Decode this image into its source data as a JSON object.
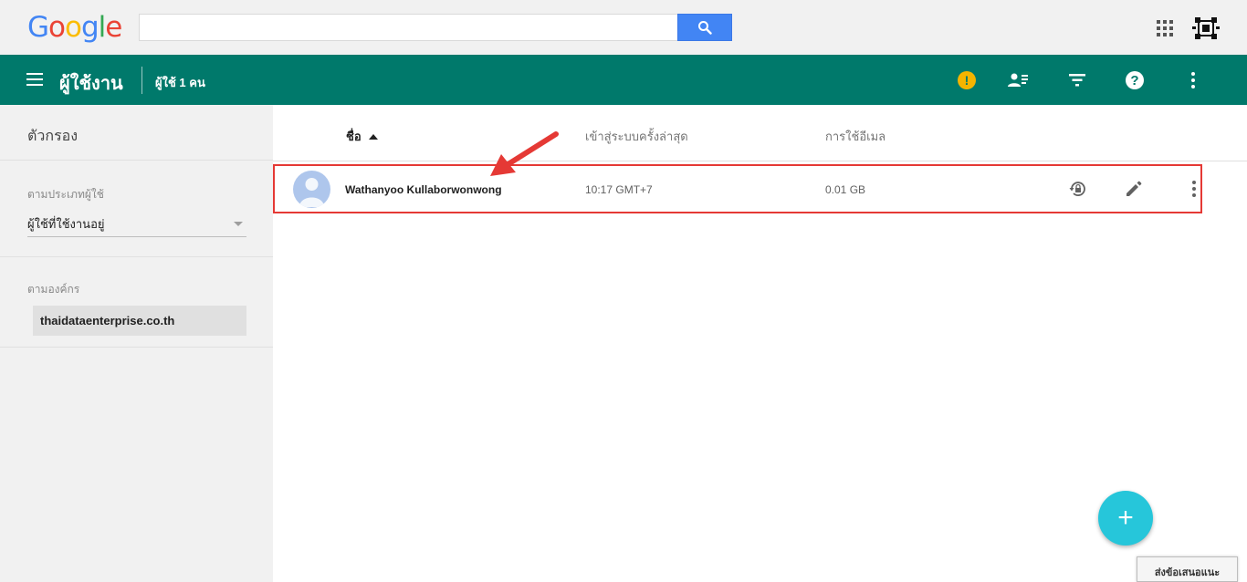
{
  "google_bar": {
    "logo_letters": [
      "G",
      "o",
      "o",
      "g",
      "l",
      "e"
    ],
    "logo_colors": [
      "#4285f4",
      "#ea4335",
      "#fbbc05",
      "#4285f4",
      "#34a853",
      "#ea4335"
    ],
    "search": {
      "value": "",
      "placeholder": ""
    },
    "icons": [
      "search-icon",
      "apps-grid-icon",
      "organization-logo"
    ]
  },
  "app_header": {
    "title": "ผู้ใช้งาน",
    "user_count": "ผู้ใช้ 1 คน",
    "accent_color": "#00796b",
    "icons": [
      "warning-icon",
      "add-user-icon",
      "filter-icon",
      "help-icon",
      "more-vert-icon"
    ]
  },
  "sidebar": {
    "title": "ตัวกรอง",
    "user_type": {
      "label": "ตามประเภทผู้ใช้",
      "selected": "ผู้ใช้ที่ใช้งานอยู่"
    },
    "org": {
      "label": "ตามองค์กร",
      "value": "thaidataenterprise.co.th"
    }
  },
  "table": {
    "columns": [
      "ชื่อ",
      "เข้าสู่ระบบครั้งล่าสุด",
      "การใช้อีเมล"
    ],
    "sort": "ascending",
    "rows": [
      {
        "name": "Wathanyoo Kullaborwonwong",
        "last_login": "10:17 GMT+7",
        "email_usage": "0.01 GB",
        "actions": [
          "reset-password-icon",
          "edit-icon",
          "more-vert-icon"
        ]
      }
    ],
    "highlight_color": "#e53935"
  },
  "fab": {
    "label": "+",
    "color": "#26c6da"
  },
  "feedback": {
    "label": "ส่งข้อเสนอแนะ"
  }
}
